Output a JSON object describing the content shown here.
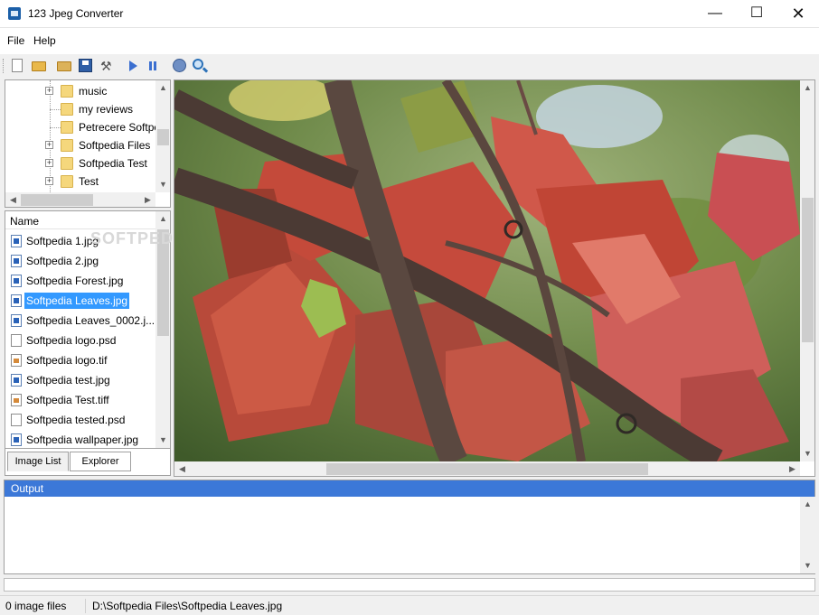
{
  "window": {
    "title": "123 Jpeg Converter",
    "minimize_glyph": "—",
    "maximize_glyph": "☐",
    "close_glyph": "✕"
  },
  "menu": {
    "items": [
      "File",
      "Help"
    ]
  },
  "toolbar": {
    "buttons": [
      "new-icon",
      "open-folder-icon",
      "open-file-icon",
      "save-icon",
      "settings-icon",
      "play-icon",
      "pause-icon",
      "web-icon",
      "search-icon"
    ]
  },
  "tree": {
    "items": [
      {
        "label": "music",
        "expandable": true
      },
      {
        "label": "my reviews",
        "expandable": false
      },
      {
        "label": "Petrecere Softpedia",
        "expandable": false
      },
      {
        "label": "Softpedia Files",
        "expandable": true
      },
      {
        "label": "Softpedia Test",
        "expandable": true
      },
      {
        "label": "Test",
        "expandable": true
      }
    ],
    "expander_glyph": "+"
  },
  "file_list": {
    "column_header": "Name",
    "watermark": "SOFTPEDIA",
    "selected_index": 3,
    "items": [
      {
        "label": "Softpedia 1.jpg",
        "icon": "jpg"
      },
      {
        "label": "Softpedia 2.jpg",
        "icon": "jpg"
      },
      {
        "label": "Softpedia Forest.jpg",
        "icon": "jpg"
      },
      {
        "label": "Softpedia Leaves.jpg",
        "icon": "jpg"
      },
      {
        "label": "Softpedia Leaves_0002.j...",
        "icon": "jpg"
      },
      {
        "label": "Softpedia logo.psd",
        "icon": "doc"
      },
      {
        "label": "Softpedia logo.tif",
        "icon": "tif"
      },
      {
        "label": "Softpedia test.jpg",
        "icon": "jpg"
      },
      {
        "label": "Softpedia Test.tiff",
        "icon": "tif"
      },
      {
        "label": "Softpedia tested.psd",
        "icon": "doc"
      },
      {
        "label": "Softpedia wallpaper.jpg",
        "icon": "jpg"
      }
    ]
  },
  "tabs": [
    {
      "label": "Image List",
      "active": true
    },
    {
      "label": "Explorer",
      "active": false
    }
  ],
  "scroll_arrows": {
    "up": "▲",
    "down": "▼",
    "left": "◀",
    "right": "▶"
  },
  "output": {
    "title": "Output",
    "text": ""
  },
  "progress": {
    "fraction": 0.0,
    "color": "#06b025"
  },
  "status": {
    "image_count": "0 image files",
    "path": "D:\\Softpedia Files\\Softpedia Leaves.jpg"
  },
  "colors": {
    "selection": "#3399ff",
    "output_header": "#3c78d8"
  }
}
